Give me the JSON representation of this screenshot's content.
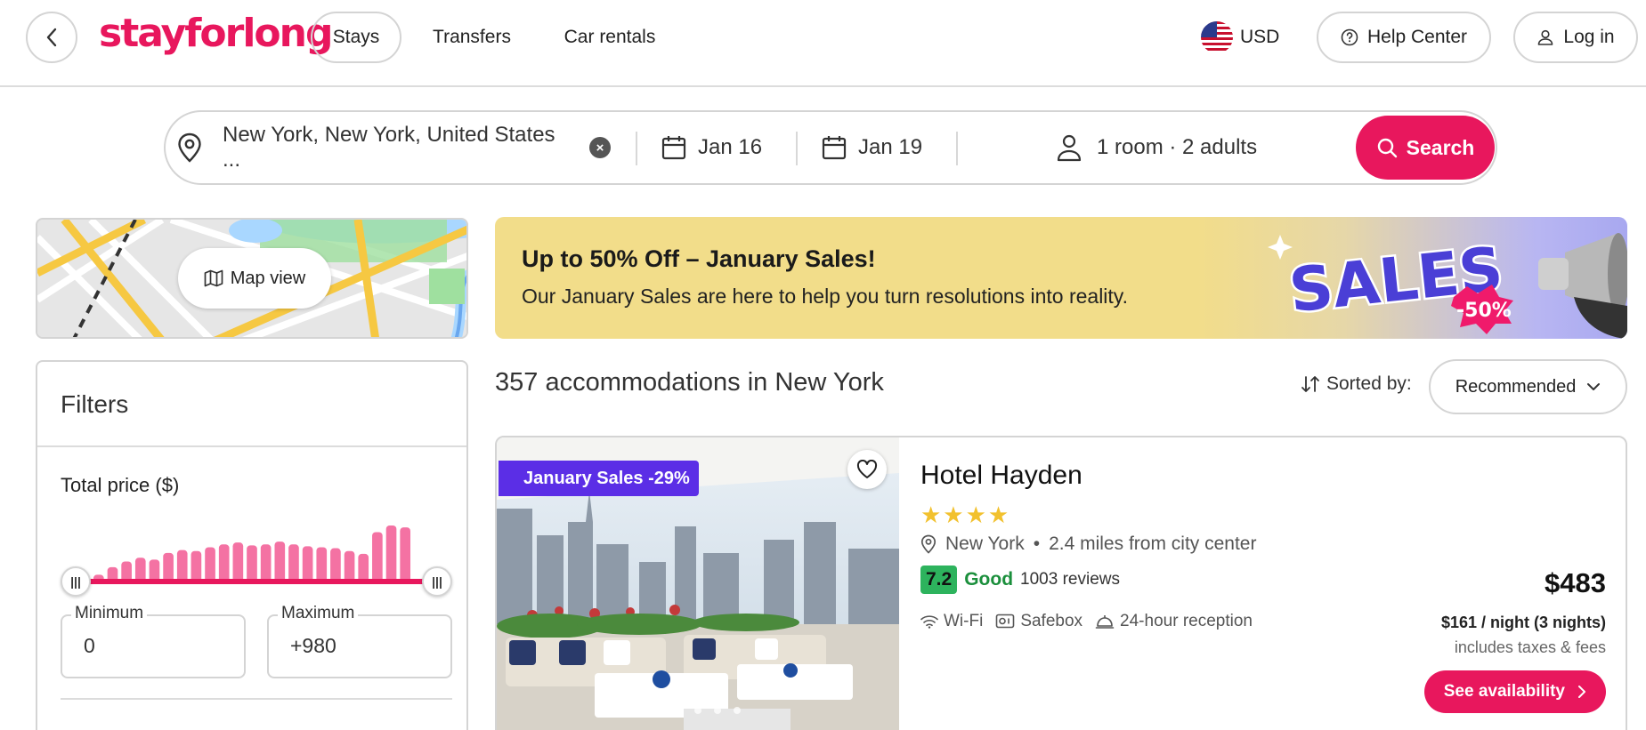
{
  "header": {
    "logo": "stayforlong",
    "tabs": [
      {
        "label": "Stays",
        "active": true
      },
      {
        "label": "Transfers",
        "active": false
      },
      {
        "label": "Car rentals",
        "active": false
      }
    ],
    "currency": "USD",
    "help_label": "Help Center",
    "login_label": "Log in"
  },
  "search": {
    "destination": "New York, New York, United States ...",
    "checkin": "Jan 16",
    "checkout": "Jan 19",
    "guests": "1 room · 2 adults",
    "button_label": "Search"
  },
  "map": {
    "button_label": "Map view"
  },
  "filters": {
    "title": "Filters",
    "price_title": "Total price ($)",
    "histogram": [
      10,
      18,
      24,
      28,
      26,
      33,
      36,
      35,
      39,
      42,
      44,
      41,
      42,
      45,
      42,
      40,
      39,
      38,
      35,
      32,
      55,
      62,
      60
    ],
    "minimum_label": "Minimum",
    "minimum_value": "0",
    "maximum_label": "Maximum",
    "maximum_value": "+980"
  },
  "banner": {
    "title": "Up to 50% Off – January Sales!",
    "subtitle": "Our January Sales are here to help you turn resolutions into reality.",
    "art_text": "SALES",
    "art_badge": "-50%"
  },
  "results": {
    "count_text": "357 accommodations in New York",
    "sorted_by_label": "Sorted by:",
    "sort_value": "Recommended"
  },
  "hotel": {
    "sale_tag": "January Sales -29%",
    "name": "Hotel Hayden",
    "stars": "★★★★",
    "city": "New York",
    "distance": "2.4 miles from city center",
    "rating_score": "7.2",
    "rating_word": "Good",
    "rating_count": "1003 reviews",
    "amenities": [
      "Wi-Fi",
      "Safebox",
      "24-hour reception"
    ],
    "price": "$483",
    "per_night": "$161 / night (3 nights)",
    "includes": "includes taxes & fees",
    "availability_label": "See availability",
    "photo_count": 5,
    "photo_index": 1
  },
  "colors": {
    "brand": "#e8175d",
    "sale_tag": "#5b2ee6",
    "rating": "#2db35d",
    "star": "#f2c12e"
  }
}
